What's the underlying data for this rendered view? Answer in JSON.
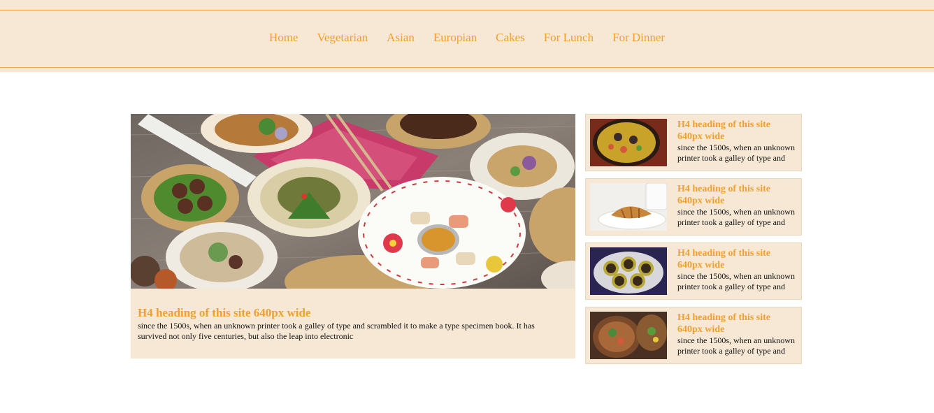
{
  "nav": {
    "items": [
      "Home",
      "Vegetarian",
      "Asian",
      "Europian",
      "Cakes",
      "For Lunch",
      "For Dinner"
    ]
  },
  "feature": {
    "heading": "H4 heading of this site 640px wide",
    "text": "since the 1500s, when an unknown printer took a galley of type and scrambled it to make a type specimen book. It has survived not only five centuries, but also the leap into electronic"
  },
  "cards": [
    {
      "heading": "H4 heading of this site 640px wide",
      "text": "since the 1500s, when an unknown printer took a galley of type and"
    },
    {
      "heading": "H4 heading of this site 640px wide",
      "text": "since the 1500s, when an unknown printer took a galley of type and"
    },
    {
      "heading": "H4 heading of this site 640px wide",
      "text": "since the 1500s, when an unknown printer took a galley of type and"
    },
    {
      "heading": "H4 heading of this site 640px wide",
      "text": "since the 1500s, when an unknown printer took a galley of type and"
    }
  ],
  "colors": {
    "accent": "#f0a030",
    "header_bg": "#f6e8d5",
    "card_bg": "#f6e8d5"
  }
}
